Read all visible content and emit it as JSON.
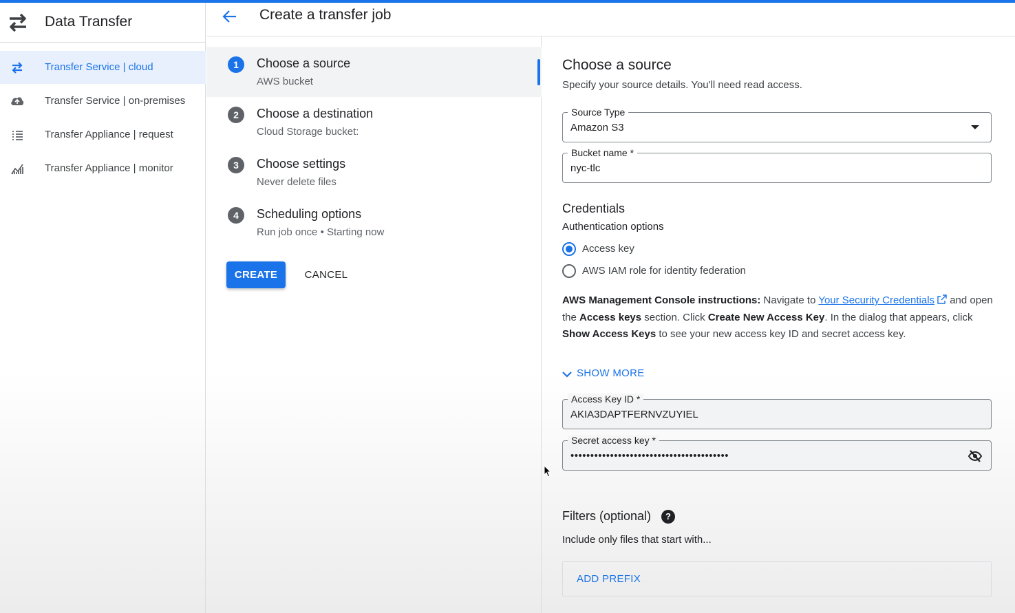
{
  "sidebar": {
    "title": "Data Transfer",
    "items": [
      {
        "label": "Transfer Service | cloud",
        "icon": "swap-icon",
        "active": true
      },
      {
        "label": "Transfer Service | on-premises",
        "icon": "cloud-upload-icon"
      },
      {
        "label": "Transfer Appliance | request",
        "icon": "list-icon"
      },
      {
        "label": "Transfer Appliance | monitor",
        "icon": "chart-icon"
      }
    ]
  },
  "header": {
    "title": "Create a transfer job"
  },
  "steps": [
    {
      "number": "1",
      "title": "Choose a source",
      "subtitle": "AWS bucket",
      "active": true
    },
    {
      "number": "2",
      "title": "Choose a destination",
      "subtitle": "Cloud Storage bucket:"
    },
    {
      "number": "3",
      "title": "Choose settings",
      "subtitle": "Never delete files"
    },
    {
      "number": "4",
      "title": "Scheduling options",
      "subtitle": "Run job once • Starting now"
    }
  ],
  "actions": {
    "create": "CREATE",
    "cancel": "CANCEL"
  },
  "form": {
    "title": "Choose a source",
    "description": "Specify your source details. You'll need read access.",
    "source_type": {
      "label": "Source Type",
      "value": "Amazon S3"
    },
    "bucket_name": {
      "label": "Bucket name *",
      "value": "nyc-tlc"
    },
    "credentials": {
      "title": "Credentials",
      "auth_label": "Authentication options",
      "options": [
        {
          "label": "Access key",
          "checked": true
        },
        {
          "label": "AWS IAM role for identity federation",
          "checked": false
        }
      ]
    },
    "instructions": {
      "lead": "AWS Management Console instructions:",
      "t1": " Navigate to ",
      "link": "Your Security Credentials",
      "t2": " and open the ",
      "b1": "Access keys",
      "t3": " section. Click ",
      "b2": "Create New Access Key",
      "t4": ". In the dialog that appears, click ",
      "b3": "Show Access Keys",
      "t5": " to see your new access key ID and secret access key."
    },
    "show_more": "SHOW MORE",
    "access_key_id": {
      "label": "Access Key ID *",
      "value": "AKIA3DAPTFERNVZUYIEL"
    },
    "secret_access_key": {
      "label": "Secret access key *",
      "value": "••••••••••••••••••••••••••••••••••••••••"
    },
    "filters": {
      "title": "Filters (optional)",
      "subtitle": "Include only files that start with...",
      "add_prefix": "ADD PREFIX"
    }
  },
  "colors": {
    "accent": "#1a73e8",
    "active_nav_bg": "#e8f0fe"
  }
}
